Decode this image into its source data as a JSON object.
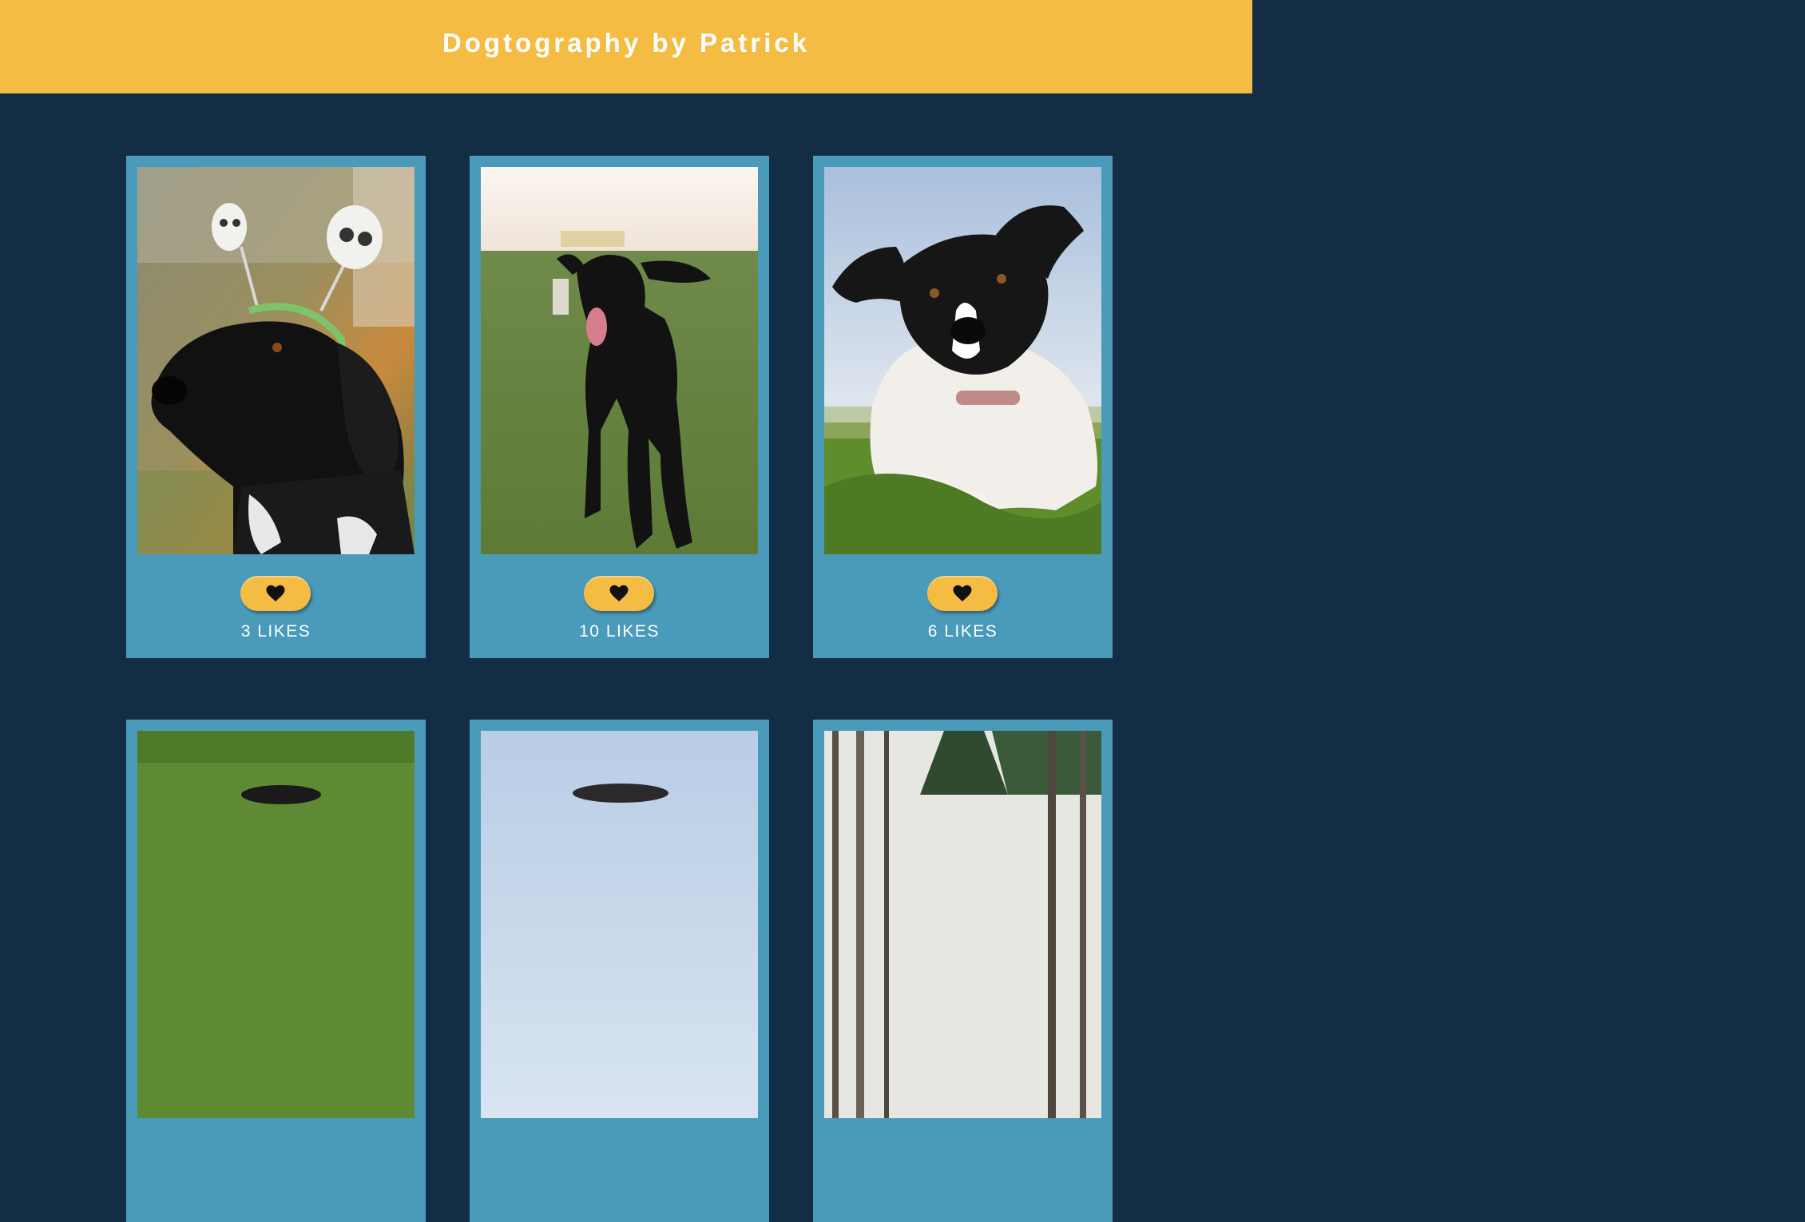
{
  "header": {
    "title": "Dogtography by Patrick"
  },
  "like_icon": "heart-icon",
  "colors": {
    "header_bg": "#f5bc43",
    "page_bg": "#132d45",
    "card_bg": "#4a9aba",
    "button_bg": "#f5bc43"
  },
  "posts": [
    {
      "likes_label": "3 LIKES",
      "image": "black-dog-skeleton-headband-photo"
    },
    {
      "likes_label": "10 LIKES",
      "image": "black-dog-running-field-photo"
    },
    {
      "likes_label": "6 LIKES",
      "image": "black-white-dog-lying-grass-photo"
    },
    {
      "image": "dog-on-grass-photo"
    },
    {
      "image": "dog-against-sky-photo"
    },
    {
      "image": "forest-trees-photo"
    }
  ]
}
